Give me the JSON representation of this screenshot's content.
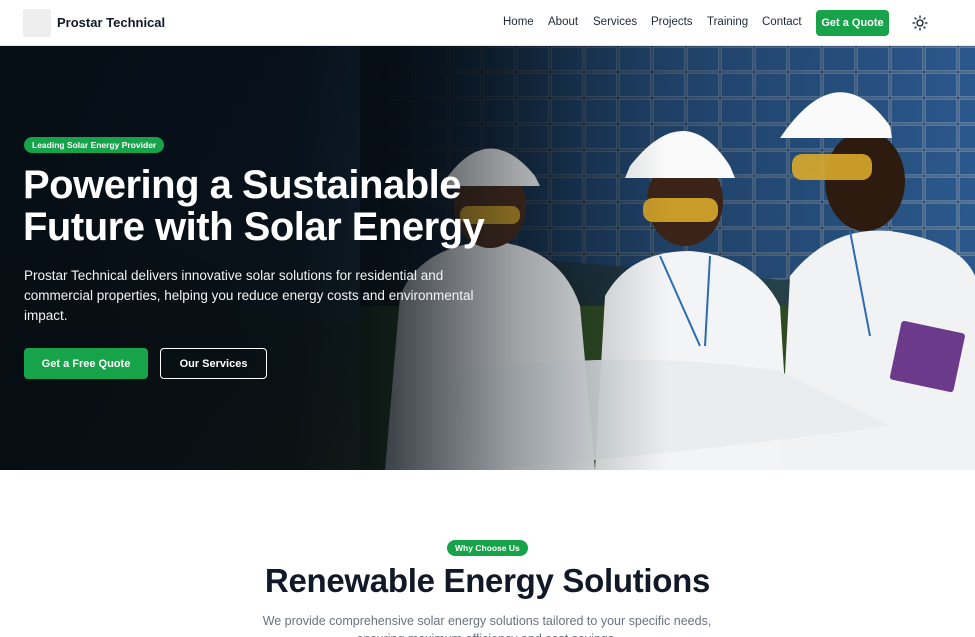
{
  "nav": {
    "brand": "Prostar Technical",
    "links": [
      "Home",
      "About",
      "Services",
      "Projects",
      "Training",
      "Contact"
    ],
    "cta": "Get a Quote",
    "theme_icon": "sun-icon"
  },
  "hero": {
    "badge": "Leading Solar Energy Provider",
    "title": "Powering a Sustainable Future with Solar Energy",
    "description": "Prostar Technical delivers innovative solar solutions for residential and commercial properties, helping you reduce energy costs and environmental impact.",
    "primary_button": "Get a Free Quote",
    "secondary_button": "Our Services"
  },
  "why": {
    "badge": "Why Choose Us",
    "title": "Renewable Energy Solutions",
    "description": "We provide comprehensive solar energy solutions tailored to your specific needs, ensuring maximum efficiency and cost savings."
  },
  "colors": {
    "accent": "#16a34a",
    "hero_overlay": "#050c12",
    "text_dark": "#111827",
    "text_muted": "#6b7280"
  }
}
